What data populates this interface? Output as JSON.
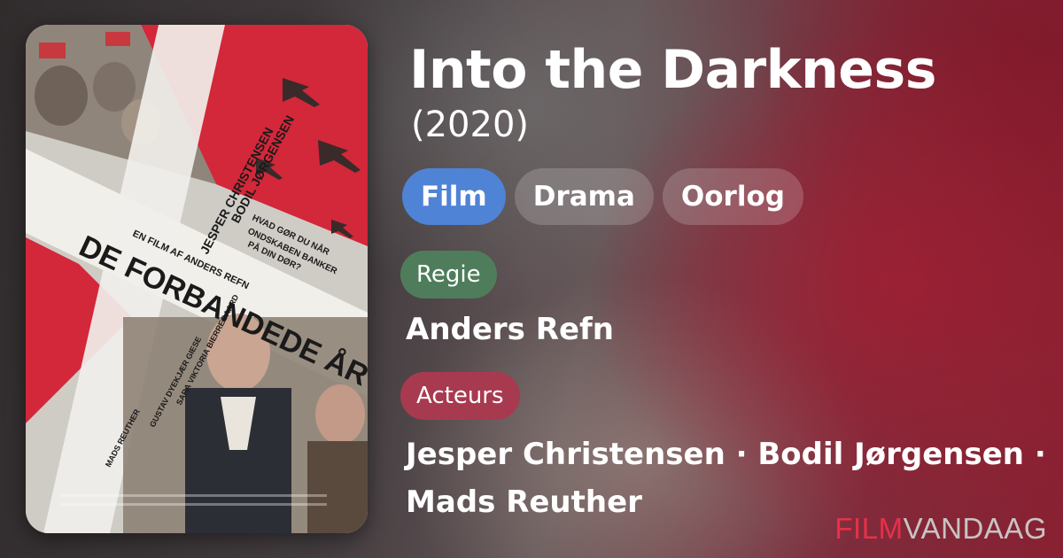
{
  "movie": {
    "title": "Into the Darkness",
    "year": "(2020)"
  },
  "genres": [
    {
      "label": "Film",
      "active": true
    },
    {
      "label": "Drama",
      "active": false
    },
    {
      "label": "Oorlog",
      "active": false
    }
  ],
  "credits": {
    "director_label": "Regie",
    "director": "Anders Refn",
    "actors_label": "Acteurs",
    "actors": "Jesper Christensen · Bodil Jørgensen · Mads Reuther"
  },
  "poster": {
    "credit_names_1": "JESPER CHRISTENSEN",
    "credit_names_2": "BODIL JØRGENSEN",
    "tagline_1": "HVAD GØR DU NÅR",
    "tagline_2": "ONDSKABEN BANKER",
    "tagline_3": "PÅ DIN DØR?",
    "subtitle": "EN FILM AF ANDERS REFN",
    "title": "DE FORBANDEDE ÅR",
    "cast_3": "SARA VIKTORIA BIERREGAARD",
    "cast_4": "GUSTAV DYEKJÆR GIESE",
    "cast_5": "MADS REUTHER"
  },
  "brand": {
    "part1": "FILM",
    "part2": "VANDAAG"
  },
  "colors": {
    "chip_active": "#4f83d6",
    "regie_badge": "#4f7d5b",
    "acteurs_badge": "#a83a50",
    "brand_red": "#e8304a"
  }
}
